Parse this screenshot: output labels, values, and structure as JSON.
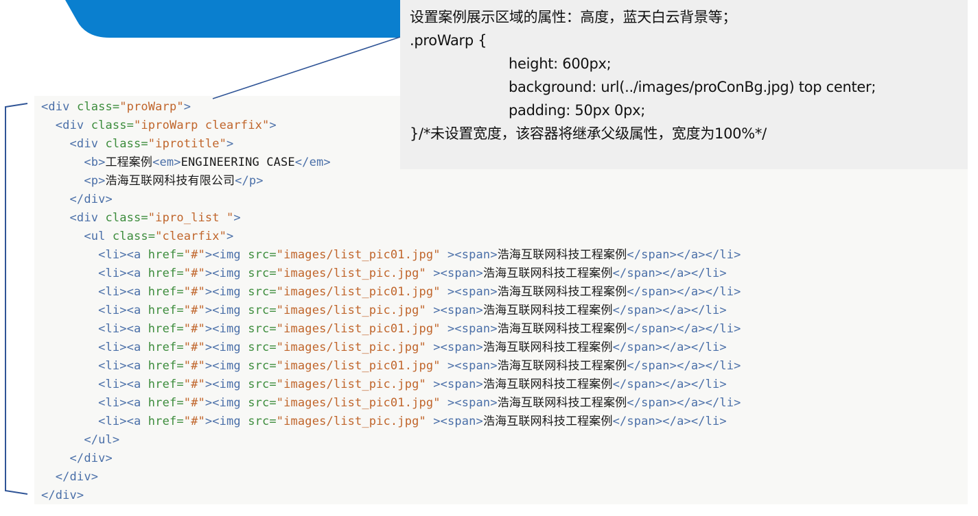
{
  "callout": {
    "lines": [
      {
        "text": "设置案例展示区域的属性：高度，蓝天白云背景等；",
        "indent": false
      },
      {
        "text": ".proWarp {",
        "indent": false
      },
      {
        "text": "height: 600px;",
        "indent": true
      },
      {
        "text": "background: url(../images/proConBg.jpg) top center;",
        "indent": true
      },
      {
        "text": "padding: 50px 0px;",
        "indent": true
      },
      {
        "text": "}/*未设置宽度，该容器将继承父级属性，宽度为100%*/",
        "indent": false
      }
    ]
  },
  "code": {
    "lines": [
      {
        "indent": 0,
        "segments": [
          [
            "tag",
            "<div "
          ],
          [
            "attr",
            "class="
          ],
          [
            "str",
            "\"proWarp\""
          ],
          [
            "tag",
            ">"
          ]
        ]
      },
      {
        "indent": 1,
        "segments": [
          [
            "tag",
            "<div "
          ],
          [
            "attr",
            "class="
          ],
          [
            "str",
            "\"iproWarp clearfix\""
          ],
          [
            "tag",
            ">"
          ]
        ]
      },
      {
        "indent": 2,
        "segments": [
          [
            "tag",
            "<div "
          ],
          [
            "attr",
            "class="
          ],
          [
            "str",
            "\"iprotitle\""
          ],
          [
            "tag",
            ">"
          ]
        ]
      },
      {
        "indent": 3,
        "segments": [
          [
            "tag",
            "<b>"
          ],
          [
            "txt",
            "工程案例"
          ],
          [
            "tag",
            "<em>"
          ],
          [
            "txt",
            "ENGINEERING CASE"
          ],
          [
            "tag",
            "</em>"
          ]
        ]
      },
      {
        "indent": 3,
        "segments": [
          [
            "tag",
            "<p>"
          ],
          [
            "txt",
            "浩海互联网科技有限公司"
          ],
          [
            "tag",
            "</p>"
          ]
        ]
      },
      {
        "indent": 2,
        "segments": [
          [
            "tag",
            "</div>"
          ]
        ]
      },
      {
        "indent": 2,
        "segments": [
          [
            "tag",
            "<div "
          ],
          [
            "attr",
            "class="
          ],
          [
            "str",
            "\"ipro_list \""
          ],
          [
            "tag",
            ">"
          ]
        ]
      },
      {
        "indent": 3,
        "segments": [
          [
            "tag",
            "<ul "
          ],
          [
            "attr",
            "class="
          ],
          [
            "str",
            "\"clearfix\""
          ],
          [
            "tag",
            ">"
          ]
        ]
      },
      {
        "indent": 4,
        "segments": [
          [
            "tag",
            "<li><a "
          ],
          [
            "attr",
            "href="
          ],
          [
            "str",
            "\"#\""
          ],
          [
            "tag",
            ">"
          ],
          [
            "tag",
            "<img "
          ],
          [
            "attr",
            "src="
          ],
          [
            "str",
            "\"images/list_pic01.jpg\""
          ],
          [
            "tag",
            " ><span>"
          ],
          [
            "txt",
            "浩海互联网科技工程案例"
          ],
          [
            "tag",
            "</span></a></li>"
          ]
        ]
      },
      {
        "indent": 4,
        "segments": [
          [
            "tag",
            "<li><a "
          ],
          [
            "attr",
            "href="
          ],
          [
            "str",
            "\"#\""
          ],
          [
            "tag",
            ">"
          ],
          [
            "tag",
            "<img "
          ],
          [
            "attr",
            "src="
          ],
          [
            "str",
            "\"images/list_pic.jpg\""
          ],
          [
            "tag",
            " ><span>"
          ],
          [
            "txt",
            "浩海互联网科技工程案例"
          ],
          [
            "tag",
            "</span></a></li>"
          ]
        ]
      },
      {
        "indent": 4,
        "segments": [
          [
            "tag",
            "<li><a "
          ],
          [
            "attr",
            "href="
          ],
          [
            "str",
            "\"#\""
          ],
          [
            "tag",
            ">"
          ],
          [
            "tag",
            "<img "
          ],
          [
            "attr",
            "src="
          ],
          [
            "str",
            "\"images/list_pic01.jpg\""
          ],
          [
            "tag",
            " ><span>"
          ],
          [
            "txt",
            "浩海互联网科技工程案例"
          ],
          [
            "tag",
            "</span></a></li>"
          ]
        ]
      },
      {
        "indent": 4,
        "segments": [
          [
            "tag",
            "<li><a "
          ],
          [
            "attr",
            "href="
          ],
          [
            "str",
            "\"#\""
          ],
          [
            "tag",
            ">"
          ],
          [
            "tag",
            "<img "
          ],
          [
            "attr",
            "src="
          ],
          [
            "str",
            "\"images/list_pic.jpg\""
          ],
          [
            "tag",
            " ><span>"
          ],
          [
            "txt",
            "浩海互联网科技工程案例"
          ],
          [
            "tag",
            "</span></a></li>"
          ]
        ]
      },
      {
        "indent": 4,
        "segments": [
          [
            "tag",
            "<li><a "
          ],
          [
            "attr",
            "href="
          ],
          [
            "str",
            "\"#\""
          ],
          [
            "tag",
            ">"
          ],
          [
            "tag",
            "<img "
          ],
          [
            "attr",
            "src="
          ],
          [
            "str",
            "\"images/list_pic01.jpg\""
          ],
          [
            "tag",
            " ><span>"
          ],
          [
            "txt",
            "浩海互联网科技工程案例"
          ],
          [
            "tag",
            "</span></a></li>"
          ]
        ]
      },
      {
        "indent": 4,
        "segments": [
          [
            "tag",
            "<li><a "
          ],
          [
            "attr",
            "href="
          ],
          [
            "str",
            "\"#\""
          ],
          [
            "tag",
            ">"
          ],
          [
            "tag",
            "<img "
          ],
          [
            "attr",
            "src="
          ],
          [
            "str",
            "\"images/list_pic.jpg\""
          ],
          [
            "tag",
            " ><span>"
          ],
          [
            "txt",
            "浩海互联网科技工程案例"
          ],
          [
            "tag",
            "</span></a></li>"
          ]
        ]
      },
      {
        "indent": 4,
        "segments": [
          [
            "tag",
            "<li><a "
          ],
          [
            "attr",
            "href="
          ],
          [
            "str",
            "\"#\""
          ],
          [
            "tag",
            ">"
          ],
          [
            "tag",
            "<img "
          ],
          [
            "attr",
            "src="
          ],
          [
            "str",
            "\"images/list_pic01.jpg\""
          ],
          [
            "tag",
            " ><span>"
          ],
          [
            "txt",
            "浩海互联网科技工程案例"
          ],
          [
            "tag",
            "</span></a></li>"
          ]
        ]
      },
      {
        "indent": 4,
        "segments": [
          [
            "tag",
            "<li><a "
          ],
          [
            "attr",
            "href="
          ],
          [
            "str",
            "\"#\""
          ],
          [
            "tag",
            ">"
          ],
          [
            "tag",
            "<img "
          ],
          [
            "attr",
            "src="
          ],
          [
            "str",
            "\"images/list_pic.jpg\""
          ],
          [
            "tag",
            " ><span>"
          ],
          [
            "txt",
            "浩海互联网科技工程案例"
          ],
          [
            "tag",
            "</span></a></li>"
          ]
        ]
      },
      {
        "indent": 4,
        "segments": [
          [
            "tag",
            "<li><a "
          ],
          [
            "attr",
            "href="
          ],
          [
            "str",
            "\"#\""
          ],
          [
            "tag",
            ">"
          ],
          [
            "tag",
            "<img "
          ],
          [
            "attr",
            "src="
          ],
          [
            "str",
            "\"images/list_pic01.jpg\""
          ],
          [
            "tag",
            " ><span>"
          ],
          [
            "txt",
            "浩海互联网科技工程案例"
          ],
          [
            "tag",
            "</span></a></li>"
          ]
        ]
      },
      {
        "indent": 4,
        "segments": [
          [
            "tag",
            "<li><a "
          ],
          [
            "attr",
            "href="
          ],
          [
            "str",
            "\"#\""
          ],
          [
            "tag",
            ">"
          ],
          [
            "tag",
            "<img "
          ],
          [
            "attr",
            "src="
          ],
          [
            "str",
            "\"images/list_pic.jpg\""
          ],
          [
            "tag",
            " ><span>"
          ],
          [
            "txt",
            "浩海互联网科技工程案例"
          ],
          [
            "tag",
            "</span></a></li>"
          ]
        ]
      },
      {
        "indent": 3,
        "segments": [
          [
            "tag",
            "</ul>"
          ]
        ]
      },
      {
        "indent": 2,
        "segments": [
          [
            "tag",
            "</div>"
          ]
        ]
      },
      {
        "indent": 1,
        "segments": [
          [
            "tag",
            "</div>"
          ]
        ]
      },
      {
        "indent": 0,
        "segments": [
          [
            "tag",
            "</div>"
          ]
        ]
      }
    ]
  },
  "colors": {
    "banner": "#0a7fcf",
    "connector": "#2f5496",
    "bracket": "#2f5496",
    "tag": "#4a6fa8",
    "attribute": "#3c8c3c",
    "string": "#c0652b"
  }
}
